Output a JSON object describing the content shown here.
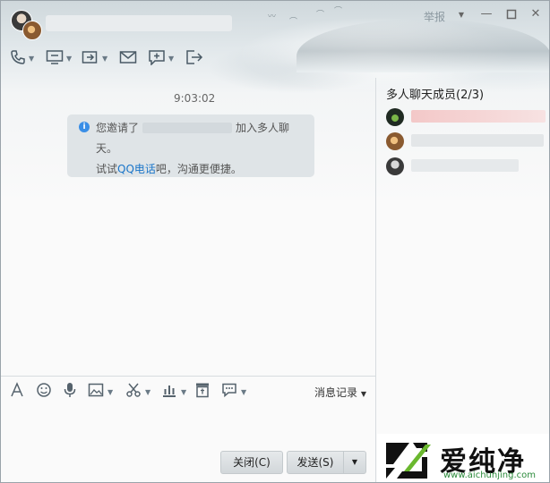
{
  "title_bar": {
    "report_label": "举报",
    "window_controls": [
      "minimize",
      "maximize",
      "close"
    ]
  },
  "toolbar": {
    "icons": [
      "phone-icon",
      "screen-share-icon",
      "file-transfer-icon",
      "mail-icon",
      "add-member-icon",
      "exit-icon"
    ]
  },
  "chat": {
    "timestamp": "9:03:02",
    "system_message": {
      "prefix": "您邀请了",
      "suffix": "加入多人聊",
      "line2": "天。",
      "line3_prefix": "试试",
      "line3_link": "QQ电话",
      "line3_suffix": "吧，沟通更便捷。"
    }
  },
  "members": {
    "title": "多人聊天成员(2/3)"
  },
  "input_toolbar": {
    "icons": [
      "font-icon",
      "emoji-icon",
      "voice-icon",
      "image-icon",
      "screenshot-icon",
      "chart-icon",
      "archive-icon",
      "chat-bubble-icon"
    ],
    "history_label": "消息记录"
  },
  "buttons": {
    "close_label": "关闭(C)",
    "send_label": "发送(S)"
  },
  "watermark": {
    "text": "爱纯净",
    "url": "www.aichunjing.com"
  }
}
